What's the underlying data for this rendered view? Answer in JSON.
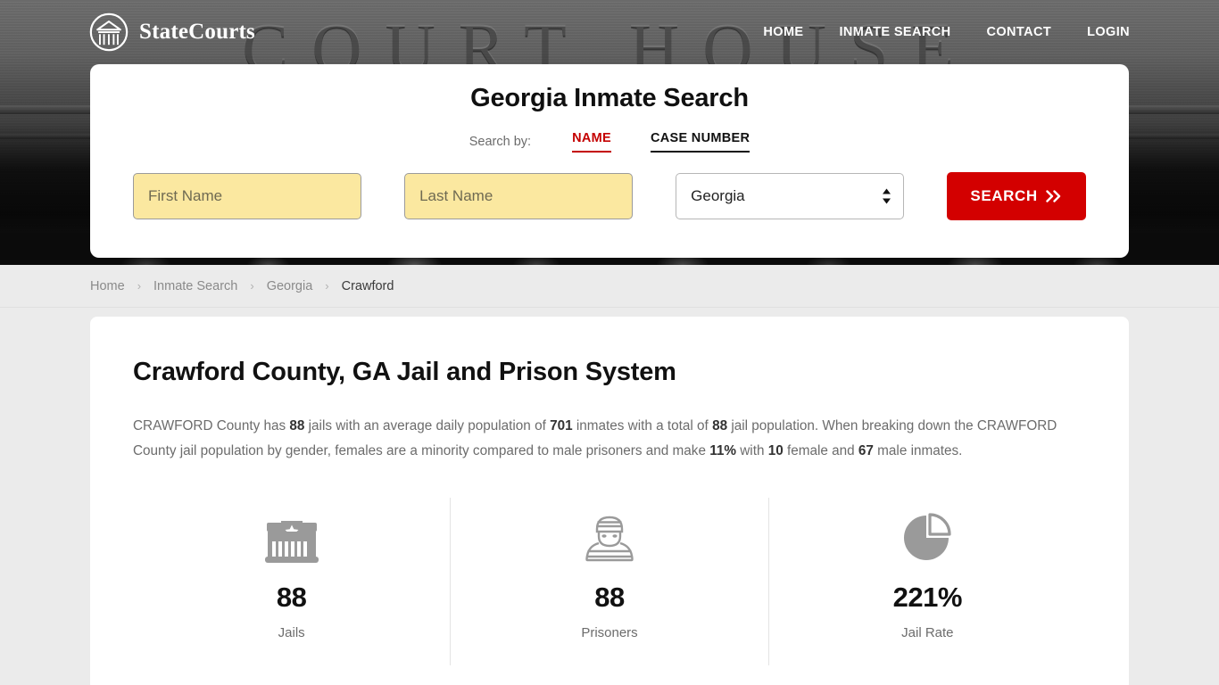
{
  "brand": {
    "name": "StateCourts",
    "logo_icon": "courthouse-circle-icon"
  },
  "nav": {
    "items": [
      {
        "label": "HOME",
        "name": "home"
      },
      {
        "label": "INMATE SEARCH",
        "name": "inmate-search"
      },
      {
        "label": "CONTACT",
        "name": "contact"
      },
      {
        "label": "LOGIN",
        "name": "login"
      }
    ]
  },
  "hero": {
    "background_text": "COURT HOUSE"
  },
  "search": {
    "title": "Georgia Inmate Search",
    "search_by_label": "Search by:",
    "tabs": [
      {
        "label": "NAME",
        "active": true,
        "color": "#c40000"
      },
      {
        "label": "CASE NUMBER",
        "active": false,
        "color": "#111111"
      }
    ],
    "first_name_placeholder": "First Name",
    "first_name_value": "",
    "last_name_placeholder": "Last Name",
    "last_name_value": "",
    "state_selected": "Georgia",
    "state_options": [
      "Georgia"
    ],
    "button_label": "SEARCH",
    "button_icon": "double-chevron-right-icon",
    "button_color": "#d30000",
    "field_color": "#fbe8a0"
  },
  "breadcrumb": {
    "items": [
      {
        "label": "Home",
        "current": false
      },
      {
        "label": "Inmate Search",
        "current": false
      },
      {
        "label": "Georgia",
        "current": false
      },
      {
        "label": "Crawford",
        "current": true
      }
    ],
    "separator": "›"
  },
  "main": {
    "title": "Crawford County, GA Jail and Prison System",
    "summary": {
      "part1": "CRAWFORD County has ",
      "b1": "88",
      "part2": " jails with an average daily population of ",
      "b2": "701",
      "part3": " inmates with a total of ",
      "b3": "88",
      "part4": " jail population. When breaking down the CRAWFORD County jail population by gender, females are a minority compared to male prisoners and make ",
      "b4": "11%",
      "part5": " with ",
      "b5": "10",
      "part6": " female and ",
      "b6": "67",
      "part7": " male inmates."
    },
    "stats": [
      {
        "icon": "jail-building-icon",
        "value": "88",
        "label": "Jails"
      },
      {
        "icon": "prisoner-icon",
        "value": "88",
        "label": "Prisoners"
      },
      {
        "icon": "pie-chart-icon",
        "value": "221%",
        "label": "Jail Rate"
      }
    ]
  }
}
